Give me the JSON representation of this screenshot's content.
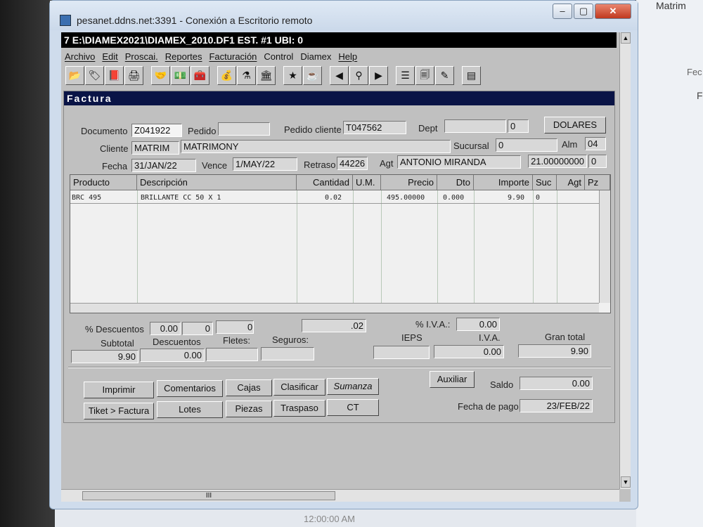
{
  "browser": {
    "tab_title": "Matrim",
    "side_label_1": "Fec",
    "side_label_2": "F",
    "clock": "12:00:00 AM"
  },
  "rdp": {
    "title": "pesanet.ddns.net:3391 - Conexión a Escritorio remoto",
    "minimize": "‒",
    "maximize": "▢",
    "close": "✕"
  },
  "app": {
    "title": "E:\\DIAMEX2021\\DIAMEX_2010.DF1  EST. #1   UBI: 0",
    "title_icon": "7",
    "menu": [
      "Archivo",
      "Edit",
      "Proscai.",
      "Reportes",
      "Facturación",
      "Control",
      "Diamex",
      "Help"
    ],
    "toolbar_icons": [
      "folder-icon",
      "tag-icon",
      "book-icon",
      "printer-icon",
      "handshake-icon",
      "money-icon",
      "safe-icon",
      "moneybag-icon",
      "scale-icon",
      "building-icon",
      "star-icon",
      "jar-icon",
      "arrow-left-icon",
      "magnifier-icon",
      "arrow-right-icon",
      "list-icon",
      "documents-icon",
      "edit-icon",
      "window-icon"
    ]
  },
  "factura": {
    "header": "Factura",
    "labels": {
      "documento": "Documento",
      "pedido": "Pedido",
      "pedido_cliente": "Pedido cliente",
      "dept": "Dept",
      "cliente": "Cliente",
      "sucursal": "Sucursal",
      "alm": "Alm",
      "fecha": "Fecha",
      "vence": "Vence",
      "retraso": "Retraso",
      "agt": "Agt"
    },
    "values": {
      "documento": "Z041922",
      "pedido": "",
      "pedido_cliente": "T047562",
      "dept": "",
      "dept_num": "0",
      "moneda": "DOLARES",
      "cliente_code": "MATRIM",
      "cliente_name": "MATRIMONY",
      "sucursal": "0",
      "alm": "04",
      "fecha": "31/JAN/22",
      "vence": "1/MAY/22",
      "retraso": "44226",
      "agt_name": "ANTONIO MIRANDA",
      "tipo_cambio": "21.00000000",
      "tc_extra": "0"
    },
    "columns": [
      "Producto",
      "Descripción",
      "Cantidad",
      "U.M.",
      "Precio",
      "Dto",
      "Importe",
      "Suc",
      "Agt",
      "Pz"
    ],
    "rows": [
      {
        "producto": "BRC 495",
        "descripcion": "BRILLANTE CC   50 X 1",
        "cantidad": "0.02",
        "um": "",
        "precio": "495.00000",
        "dto": "0.000",
        "importe": "9.90",
        "suc": "0",
        "agt": "",
        "pz": ""
      }
    ]
  },
  "totales": {
    "pct_descuentos_label": "% Descuentos",
    "pct_desc_1": "0.00",
    "pct_desc_2": "0",
    "pct_desc_3": "0",
    "cantidad_total": ".02",
    "iva_pct_label": "% I.V.A.:",
    "iva_pct": "0.00",
    "subtotal_label": "Subtotal",
    "subtotal": "9.90",
    "descuentos_label": "Descuentos",
    "descuentos": "0.00",
    "fletes_label": "Fletes:",
    "fletes": "",
    "seguros_label": "Seguros:",
    "seguros": "",
    "ieps_label": "IEPS",
    "ieps": "",
    "iva_label": "I.V.A.",
    "iva": "0.00",
    "gran_total_label": "Gran total",
    "gran_total": "9.90",
    "saldo_label": "Saldo",
    "saldo": "0.00",
    "fecha_pago_label": "Fecha de pago",
    "fecha_pago": "23/FEB/22"
  },
  "buttons": {
    "imprimir": "Imprimir",
    "comentarios": "Comentarios",
    "cajas": "Cajas",
    "clasificar": "Clasificar",
    "sumanza": "Sumanza",
    "auxiliar": "Auxiliar",
    "tiket": "Tiket > Factura",
    "lotes": "Lotes",
    "piezas": "Piezas",
    "traspaso": "Traspaso",
    "ct": "CT"
  },
  "scroll_thumb": "III"
}
